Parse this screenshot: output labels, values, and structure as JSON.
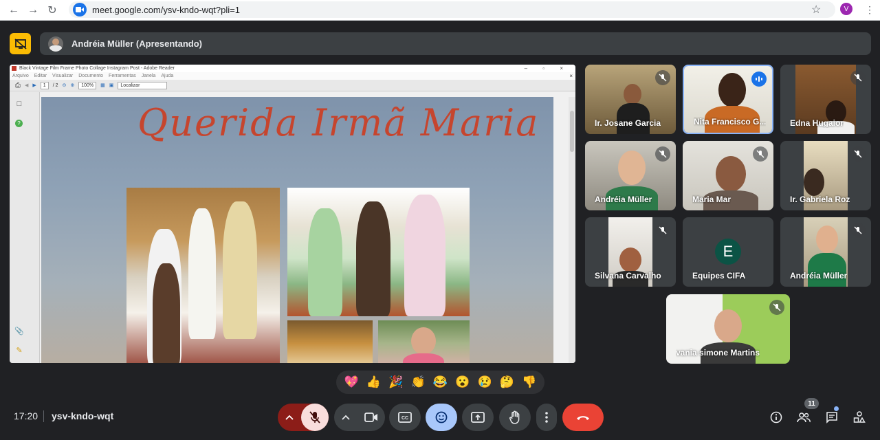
{
  "browser": {
    "url": "meet.google.com/ysv-kndo-wqt?pli=1",
    "profile_initial": "V"
  },
  "presenter": {
    "label": "Andréia Müller (Apresentando)"
  },
  "reader": {
    "window_title": "Black Vintage Film Frame Photo Collage Instagram Post - Adobe Reader",
    "menu": [
      "Arquivo",
      "Editar",
      "Visualizar",
      "Documento",
      "Ferramentas",
      "Janela",
      "Ajuda"
    ],
    "page_current": "1",
    "page_total": "/ 2",
    "zoom": "100%",
    "find_placeholder": "Localizar",
    "doc_title": "Querida Irmã Maria"
  },
  "participants": [
    {
      "name": "Ir. Josane Garcia",
      "muted": true
    },
    {
      "name": "Nita Francisco G...",
      "speaking": true
    },
    {
      "name": "Edna Hugaior",
      "muted": true
    },
    {
      "name": "Andréia Müller",
      "muted": true
    },
    {
      "name": "Maria Mar",
      "muted": true
    },
    {
      "name": "Ir. Gabriela Roz",
      "muted": true
    },
    {
      "name": "Silvana Carvalho",
      "muted": true
    },
    {
      "name": "Equipes CIFA",
      "avatar_letter": "E",
      "avatar_color": "#0b5345"
    },
    {
      "name": "Andréia Müller",
      "muted": true
    },
    {
      "name": "vania simone Martins",
      "muted": true
    }
  ],
  "reactions": [
    "💖",
    "👍",
    "🎉",
    "👏",
    "😂",
    "😮",
    "😢",
    "🤔",
    "👎"
  ],
  "meeting": {
    "time": "17:20",
    "code": "ysv-kndo-wqt",
    "participant_count": "11"
  },
  "colors": {
    "accent": "#1a73e8",
    "end_call": "#ea4335",
    "present_highlight": "#fbbc04"
  }
}
